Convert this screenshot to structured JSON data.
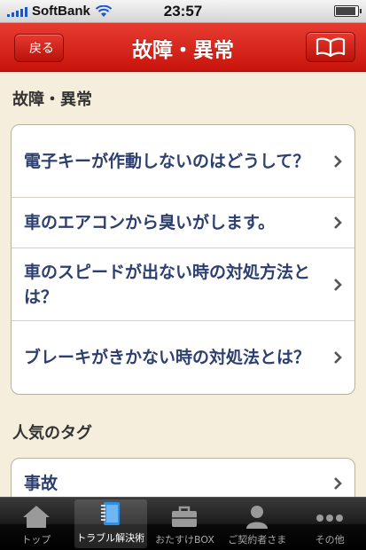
{
  "status_bar": {
    "carrier": "SoftBank",
    "time": "23:57",
    "battery_level": 0.95
  },
  "nav": {
    "back_label": "戻る",
    "title": "故障・異常",
    "book_icon": "book-icon"
  },
  "sections": [
    {
      "title": "故障・異常",
      "items": [
        {
          "label": "電子キーが作動しないのはどうして？"
        },
        {
          "label": "車のエアコンから臭いがします。"
        },
        {
          "label": "車のスピードが出ない時の対処方法とは？"
        },
        {
          "label": "ブレーキがきかない時の対処法とは？"
        }
      ]
    },
    {
      "title": "人気のタグ",
      "items": [
        {
          "label": "事故"
        }
      ]
    }
  ],
  "tabs": [
    {
      "label": "トップ",
      "icon": "home-icon",
      "active": false
    },
    {
      "label": "トラブル解決術",
      "icon": "notebook-icon",
      "active": true
    },
    {
      "label": "おたすけBOX",
      "icon": "toolbox-icon",
      "active": false
    },
    {
      "label": "ご契約者さま",
      "icon": "person-icon",
      "active": false
    },
    {
      "label": "その他",
      "icon": "more-icon",
      "active": false
    }
  ],
  "colors": {
    "nav_red": "#d42419",
    "background": "#f6eedc",
    "item_text": "#2d3f6e"
  }
}
